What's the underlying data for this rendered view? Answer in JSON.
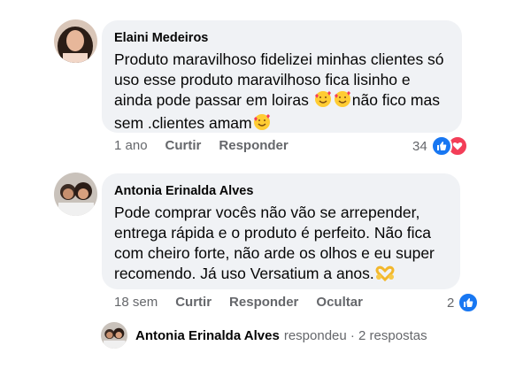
{
  "comments": [
    {
      "author": "Elaini Medeiros",
      "lines": [
        "Produto maravilhoso fidelizei minhas clientes só",
        "uso esse produto maravilhoso fica lisinho  e",
        "ainda pode passar em loiras",
        "não fico mas",
        "sem .clientes  amam"
      ],
      "time": "1 ano",
      "actions": [
        "Curtir",
        "Responder"
      ],
      "reaction_count": "34",
      "reaction_icons": [
        "like-icon",
        "love-icon"
      ]
    },
    {
      "author": "Antonia Erinalda Alves",
      "lines": [
        "Pode comprar vocês não vão se arrepender,",
        "entrega rápida e o produto é perfeito. Não fica",
        "com cheiro forte, não arde os olhos e eu super",
        "recomendo. Já uso Versatium a anos."
      ],
      "time": "18 sem",
      "actions": [
        "Curtir",
        "Responder",
        "Ocultar"
      ],
      "reaction_count": "2",
      "reaction_icons": [
        "like-icon"
      ]
    }
  ],
  "reply_summary": {
    "author": "Antonia Erinalda Alves",
    "text": "respondeu · 2 respostas"
  },
  "colors": {
    "bubble": "#f0f2f5",
    "secondary_text": "#65676b",
    "like_blue": "#1877f2",
    "love_red": "#f33e58"
  }
}
